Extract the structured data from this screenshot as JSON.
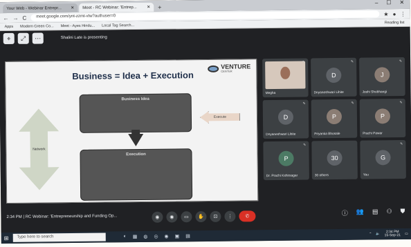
{
  "browser": {
    "tabs": [
      {
        "label": "Your Web - Webinar Entrepr..."
      },
      {
        "label": "Meet - RC Webinar: 'Entrep..."
      }
    ],
    "new_tab": "+",
    "window_controls": [
      "–",
      "☐",
      "✕"
    ],
    "nav_buttons": [
      "←",
      "→",
      "C"
    ],
    "url": "meet.google.com/ynt-zzmt-vtw?authuser=0",
    "menu_icons": [
      "★",
      "●",
      "⋮"
    ],
    "bookmarks": [
      {
        "label": "Apps"
      },
      {
        "label": "Modern Green Co..."
      },
      {
        "label": "Meet - Ayes Hindu..."
      },
      {
        "label": "Local Tag Search..."
      }
    ],
    "bookmarks_right": "Reading list"
  },
  "meet": {
    "presenting_text": "Shalini Late is presenting",
    "slide": {
      "brand": "VENTURE",
      "brand_sub": "CENTER",
      "title": "Business = Idea + Execution",
      "box1_title": "Business Idea",
      "box1_text": "",
      "box2_title": "Execution",
      "box2_text": "",
      "side_arrow_label": "Network",
      "left_arrow_label": "Execute"
    },
    "participants": [
      {
        "name": "Megha",
        "type": "video"
      },
      {
        "name": "Dnyaneshwari Lihite",
        "initial": "D"
      },
      {
        "name": "Joshi Shubhangi",
        "initial": "J"
      },
      {
        "name": "Dnyaneshwari Lihite",
        "initial": "D"
      },
      {
        "name": "Priyanka Bhosale",
        "initial": "P"
      },
      {
        "name": "Prachi Pawar",
        "initial": "P"
      },
      {
        "name": "Dr. Prachi Kshirsagar",
        "initial": "P"
      },
      {
        "name": "30 others",
        "initial": "30"
      },
      {
        "name": "You",
        "initial": "G"
      }
    ],
    "meeting_time": "2:34 PM",
    "meeting_title": "RC Webinar: 'Entrepreneurship and Funding Op...",
    "control_icons": [
      "◉",
      "◉",
      "▭",
      "✋",
      "⊡",
      "⋮",
      "✆"
    ]
  },
  "taskbar": {
    "start_icon": "⊞",
    "search_placeholder": "Type here to search",
    "app_icons": [
      "◐",
      "▦",
      "◍",
      "◎",
      "◉",
      "▣",
      "▤"
    ],
    "tray": {
      "time": "2:34 PM",
      "date": "15-Sep-21"
    }
  },
  "colors": {
    "meet_bg": "#202124",
    "tile_bg": "#3c4043",
    "end_call": "#d93025"
  }
}
